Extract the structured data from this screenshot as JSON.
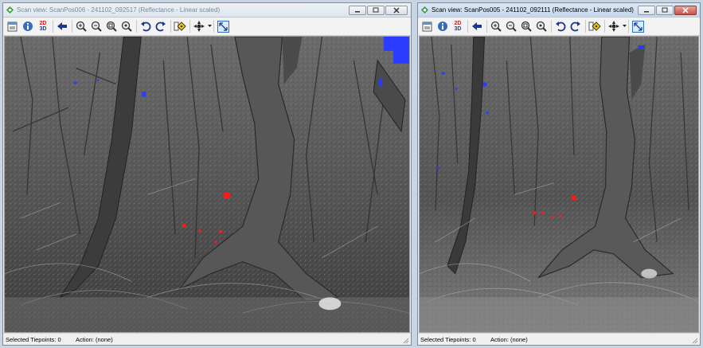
{
  "windows": [
    {
      "title": "Scan view: ScanPos006 - 241102_092517 (Reflectance - Linear scaled)",
      "state": "inactive",
      "status": {
        "selected_tiepoints": "Selected Tiepoints: 0",
        "action": "Action: (none)"
      }
    },
    {
      "title": "Scan view: ScanPos005 - 241102_092111 (Reflectance - Linear scaled)",
      "state": "active",
      "status": {
        "selected_tiepoints": "Selected Tiepoints: 0",
        "action": "Action: (none)"
      }
    }
  ],
  "toolbar": {
    "toggle_2d3d_top": "2D",
    "toggle_2d3d_bottom": "3D",
    "icons": [
      "properties-icon",
      "info-icon",
      "2d-3d-toggle-icon",
      "back-arrow-icon",
      "zoom-in-icon",
      "zoom-out-icon",
      "zoom-fit-icon",
      "zoom-window-icon",
      "undo-icon",
      "redo-icon",
      "tiepoint-tool-icon",
      "navigation-tool-icon",
      "fit-view-icon"
    ]
  },
  "colors": {
    "tiepoint_marker": "#ff1a1a",
    "saturated_pixels": "#2a3cff",
    "desktop": "#c9d5e2"
  }
}
